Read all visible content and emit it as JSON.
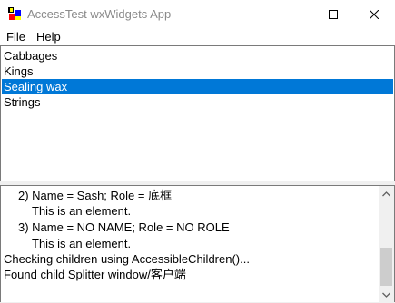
{
  "window": {
    "title": "AccessTest wxWidgets App",
    "icon": "app-icon"
  },
  "titlebar": {
    "minimize_icon": "minimize-icon",
    "maximize_icon": "maximize-icon",
    "close_icon": "close-icon"
  },
  "menu": {
    "items": [
      {
        "label": "File"
      },
      {
        "label": "Help"
      }
    ]
  },
  "listbox": {
    "items": [
      {
        "label": "Cabbages"
      },
      {
        "label": "Kings"
      },
      {
        "label": "Sealing wax"
      },
      {
        "label": "Strings"
      }
    ],
    "selected": "Sealing wax",
    "selection_color": "#0078d7"
  },
  "log": {
    "lines": [
      {
        "text": "2) Name = Sash; Role = 底框"
      },
      {
        "text": "This is an element."
      },
      {
        "text": "3) Name = NO NAME; Role = NO ROLE"
      },
      {
        "text": "This is an element."
      },
      {
        "text": "Checking children using AccessibleChildren()..."
      },
      {
        "text": "Found child Splitter window/客户端"
      }
    ],
    "scrollbar": {
      "up_icon": "scroll-up-arrow-icon",
      "down_icon": "scroll-down-arrow-icon"
    }
  }
}
